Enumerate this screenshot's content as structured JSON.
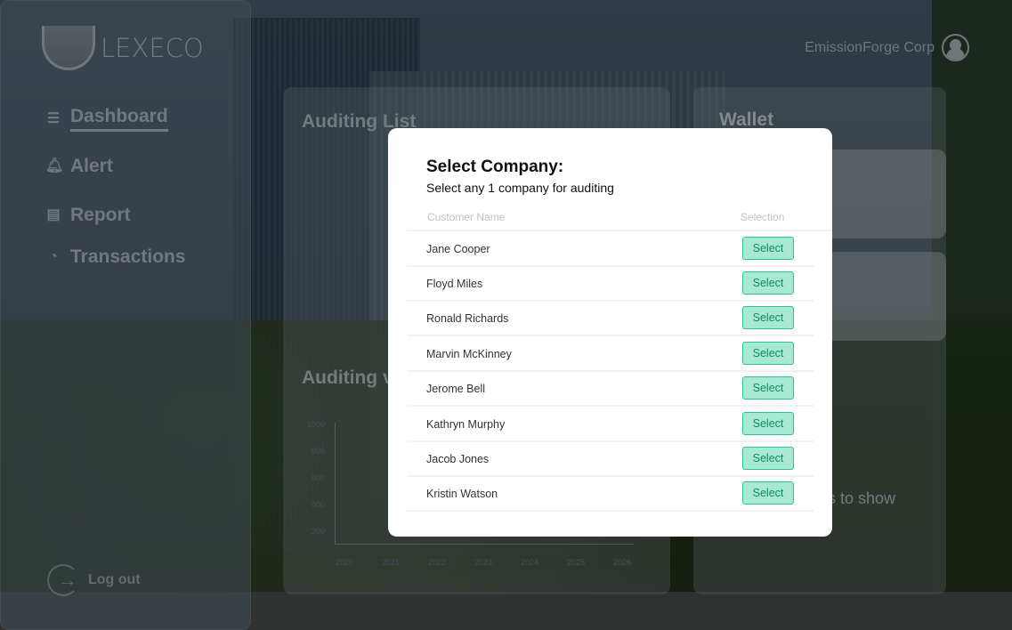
{
  "brand": {
    "name": "LEXECO"
  },
  "sidebar": {
    "items": [
      {
        "label": "Dashboard",
        "icon": "server-icon",
        "active": true
      },
      {
        "label": "Alert",
        "icon": "bell-icon"
      },
      {
        "label": "Report",
        "icon": "report-file-icon"
      },
      {
        "label": "Transactions",
        "icon": "clock-icon"
      }
    ],
    "logout": "Log out"
  },
  "header": {
    "user": "EmissionForge Corp"
  },
  "main": {
    "auditing_list": "Auditing List",
    "auditing_chart_title": "Auditing v",
    "wallet": "Wallet",
    "empty_text": "s to show",
    "chart": {
      "y_ticks": [
        "1000",
        "800",
        "600",
        "400",
        "200"
      ],
      "x_ticks": [
        "2020",
        "2021",
        "2022",
        "2023",
        "2024",
        "2025",
        "2026"
      ]
    }
  },
  "modal": {
    "title": "Select Company:",
    "subtitle": "Select any 1 company for auditing",
    "columns": [
      "Customer Name",
      "Selection"
    ],
    "button_label": "Select",
    "rows": [
      "Jane Cooper",
      "Floyd Miles",
      "Ronald Richards",
      "Marvin McKinney",
      "Jerome Bell",
      "Kathryn Murphy",
      "Jacob Jones",
      "Kristin Watson"
    ]
  },
  "colors": {
    "select_bg": "#a8e9d5",
    "select_border": "#33c08f",
    "select_text": "#118a5f"
  }
}
